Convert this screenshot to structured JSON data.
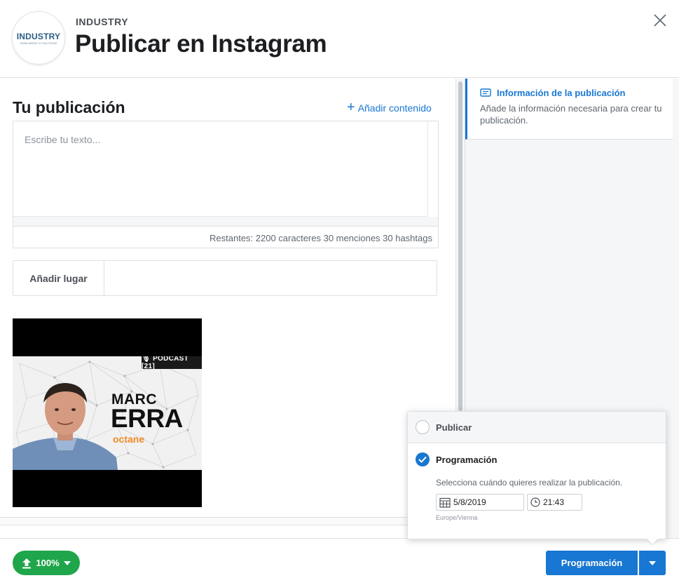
{
  "header": {
    "page_name": "INDUSTRY",
    "title": "Publicar en Instagram",
    "logo": {
      "text": "INDUSTRY",
      "subtext": "FROM NEEDS TO SOLUTIONS"
    },
    "close_icon": "close-icon"
  },
  "composer": {
    "section_title": "Tu publicación",
    "add_content_label": "Añadir contenido",
    "text_placeholder": "Escribe tu texto...",
    "counter": "Restantes: 2200 caracteres 30 menciones 30 hashtags",
    "place_label": "Añadir lugar",
    "place_value": ""
  },
  "media": {
    "podcast_tag": "🎙 PODCAST [21]",
    "guest_first": "MARC",
    "guest_last": "ERRA",
    "brand": "octane"
  },
  "side_panel": {
    "title": "Información de la publicación",
    "description": "Añade la información necesaria para crear tu publicación."
  },
  "footer": {
    "progress_label": "100%",
    "primary_button": "Programación"
  },
  "schedule_popover": {
    "publish_label": "Publicar",
    "schedule_label": "Programación",
    "hint": "Selecciona cuándo quieres realizar la publicación.",
    "date": "5/8/2019",
    "time": "21:43",
    "timezone": "Europe/Vienna"
  },
  "colors": {
    "accent": "#1877d2",
    "success": "#1fa54a",
    "brand_orange": "#f08a24"
  }
}
